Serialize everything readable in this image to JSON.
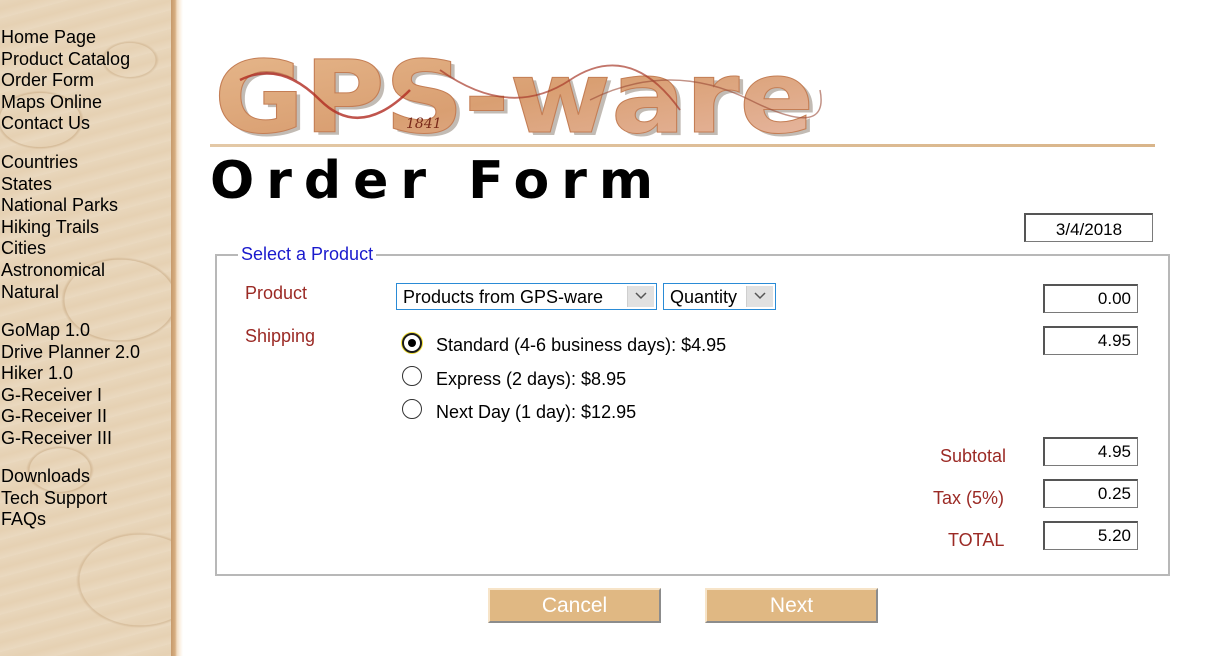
{
  "sidebar": {
    "group1": [
      "Home Page",
      "Product Catalog",
      "Order Form",
      "Maps Online",
      "Contact Us"
    ],
    "group2": [
      "Countries",
      "States",
      "National Parks",
      "Hiking Trails",
      "Cities",
      "Astronomical",
      "Natural"
    ],
    "group3": [
      "GoMap 1.0",
      "Drive Planner 2.0",
      "Hiker 1.0",
      "G-Receiver I",
      "G-Receiver II",
      "G-Receiver III"
    ],
    "group4": [
      "Downloads",
      "Tech Support",
      "FAQs"
    ]
  },
  "header": {
    "logo_text": "GPS-ware",
    "logo_year": "1841",
    "title": "Order Form"
  },
  "form": {
    "date": "3/4/2018",
    "legend": "Select a Product",
    "product_label": "Product",
    "product_select": "Products from GPS-ware",
    "quantity_select": "Quantity",
    "product_cost": "0.00",
    "shipping_label": "Shipping",
    "shipping_cost": "4.95",
    "shipping_options": [
      {
        "label": "Standard (4-6 business days): $4.95",
        "checked": true
      },
      {
        "label": "Express (2 days): $8.95",
        "checked": false
      },
      {
        "label": "Next Day (1 day): $12.95",
        "checked": false
      }
    ],
    "subtotal_label": "Subtotal",
    "subtotal": "4.95",
    "tax_label": "Tax (5%)",
    "tax": "0.25",
    "total_label": "TOTAL",
    "total": "5.20"
  },
  "buttons": {
    "cancel": "Cancel",
    "next": "Next"
  },
  "colors": {
    "accent_tan": "#e0b883",
    "label_red": "#9b2a25",
    "legend_blue": "#1a1acd"
  }
}
